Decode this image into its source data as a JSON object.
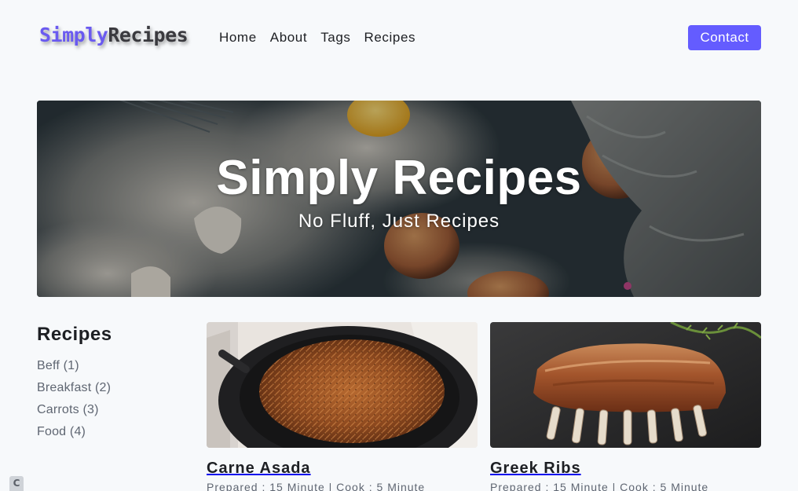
{
  "nav": {
    "logo_part1": "Simply",
    "logo_part2": "Recipes",
    "links": [
      "Home",
      "About",
      "Tags",
      "Recipes"
    ],
    "contact_label": "Contact"
  },
  "hero": {
    "title": "Simply Recipes",
    "subtitle": "No Fluff, Just Recipes"
  },
  "sidebar": {
    "title": "Recipes",
    "tags": [
      "Beff (1)",
      "Breakfast (2)",
      "Carrots (3)",
      "Food (4)"
    ]
  },
  "recipes": [
    {
      "title": "Carne Asada",
      "meta": "Prepared : 15 Minute | Cook : 5 Minute",
      "image": "pan-of-shredded-beef"
    },
    {
      "title": "Greek Ribs",
      "meta": "Prepared : 15 Minute | Cook : 5 Minute",
      "image": "rack-of-ribs"
    }
  ],
  "colors": {
    "accent": "#645cff",
    "logo_accent": "#6a5af0",
    "background": "#f7f9fb",
    "text": "#1d1f23",
    "muted_text": "#5f6672"
  }
}
